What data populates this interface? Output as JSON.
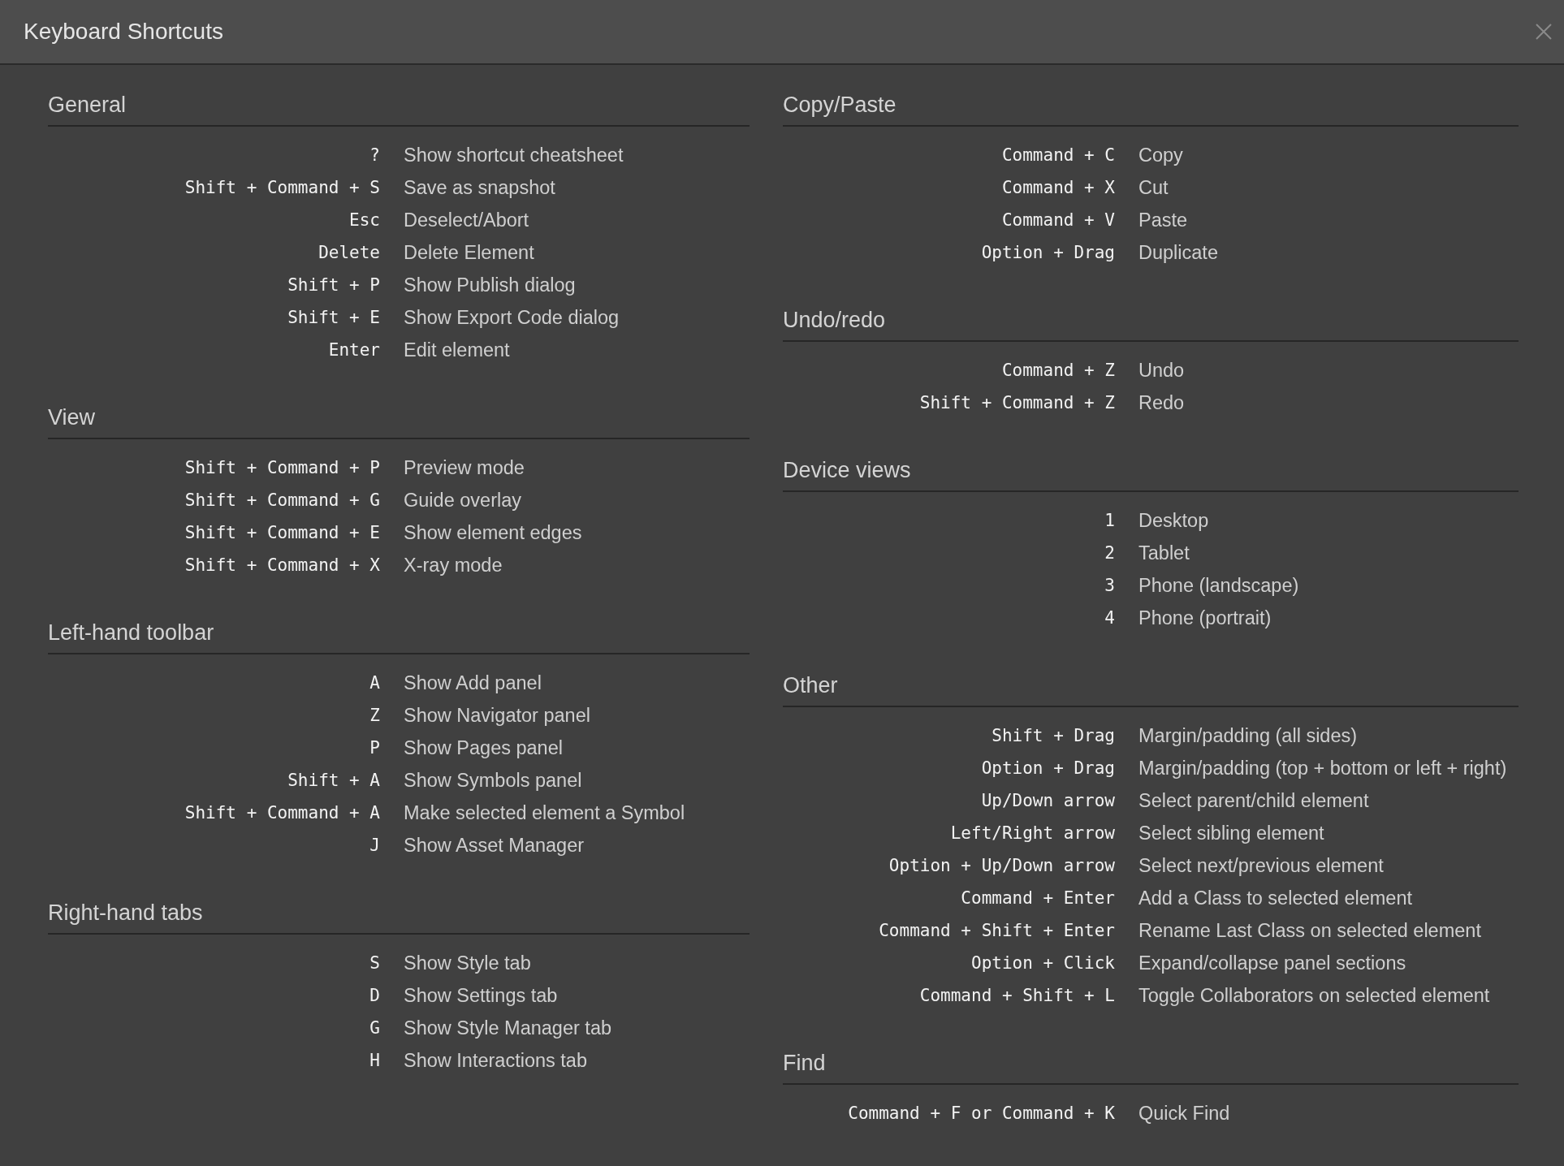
{
  "window": {
    "title": "Keyboard Shortcuts"
  },
  "columns": [
    {
      "sections": [
        {
          "title": "General",
          "shortcuts": [
            {
              "keys": "?",
              "action": "Show shortcut cheatsheet"
            },
            {
              "keys": "Shift + Command + S",
              "action": "Save as snapshot"
            },
            {
              "keys": "Esc",
              "action": "Deselect/Abort"
            },
            {
              "keys": "Delete",
              "action": "Delete Element"
            },
            {
              "keys": "Shift + P",
              "action": "Show Publish dialog"
            },
            {
              "keys": "Shift + E",
              "action": "Show Export Code dialog"
            },
            {
              "keys": "Enter",
              "action": "Edit element"
            }
          ]
        },
        {
          "title": "View",
          "shortcuts": [
            {
              "keys": "Shift + Command + P",
              "action": "Preview mode"
            },
            {
              "keys": "Shift + Command + G",
              "action": "Guide overlay"
            },
            {
              "keys": "Shift + Command + E",
              "action": "Show element edges"
            },
            {
              "keys": "Shift + Command + X",
              "action": "X-ray mode"
            }
          ]
        },
        {
          "title": "Left-hand toolbar",
          "shortcuts": [
            {
              "keys": "A",
              "action": "Show Add panel"
            },
            {
              "keys": "Z",
              "action": "Show Navigator panel"
            },
            {
              "keys": "P",
              "action": "Show Pages panel"
            },
            {
              "keys": "Shift + A",
              "action": "Show Symbols panel"
            },
            {
              "keys": "Shift + Command + A",
              "action": "Make selected element a Symbol"
            },
            {
              "keys": "J",
              "action": "Show Asset Manager"
            }
          ]
        },
        {
          "title": "Right-hand tabs",
          "shortcuts": [
            {
              "keys": "S",
              "action": "Show Style tab"
            },
            {
              "keys": "D",
              "action": "Show Settings tab"
            },
            {
              "keys": "G",
              "action": "Show Style Manager tab"
            },
            {
              "keys": "H",
              "action": "Show Interactions tab"
            }
          ]
        }
      ]
    },
    {
      "sections": [
        {
          "title": "Copy/Paste",
          "shortcuts": [
            {
              "keys": "Command + C",
              "action": "Copy"
            },
            {
              "keys": "Command + X",
              "action": "Cut"
            },
            {
              "keys": "Command + V",
              "action": "Paste"
            },
            {
              "keys": "Option + Drag",
              "action": "Duplicate"
            }
          ]
        },
        {
          "title": "Undo/redo",
          "shortcuts": [
            {
              "keys": "Command + Z",
              "action": "Undo"
            },
            {
              "keys": "Shift + Command + Z",
              "action": "Redo"
            }
          ]
        },
        {
          "title": "Device views",
          "shortcuts": [
            {
              "keys": "1",
              "action": "Desktop"
            },
            {
              "keys": "2",
              "action": "Tablet"
            },
            {
              "keys": "3",
              "action": "Phone (landscape)"
            },
            {
              "keys": "4",
              "action": "Phone (portrait)"
            }
          ]
        },
        {
          "title": "Other",
          "shortcuts": [
            {
              "keys": "Shift + Drag",
              "action": "Margin/padding (all sides)"
            },
            {
              "keys": "Option + Drag",
              "action": "Margin/padding (top + bottom or left + right)"
            },
            {
              "keys": "Up/Down arrow",
              "action": "Select parent/child element"
            },
            {
              "keys": "Left/Right arrow",
              "action": "Select sibling element"
            },
            {
              "keys": "Option + Up/Down arrow",
              "action": "Select next/previous element"
            },
            {
              "keys": "Command + Enter",
              "action": "Add a Class to selected element"
            },
            {
              "keys": "Command + Shift + Enter",
              "action": "Rename Last Class on selected element"
            },
            {
              "keys": "Option + Click",
              "action": "Expand/collapse panel sections"
            },
            {
              "keys": "Command + Shift + L",
              "action": "Toggle Collaborators on selected element"
            }
          ]
        },
        {
          "title": "Find",
          "shortcuts": [
            {
              "keys": "Command + F or Command + K",
              "action": "Quick Find"
            }
          ]
        }
      ]
    }
  ]
}
